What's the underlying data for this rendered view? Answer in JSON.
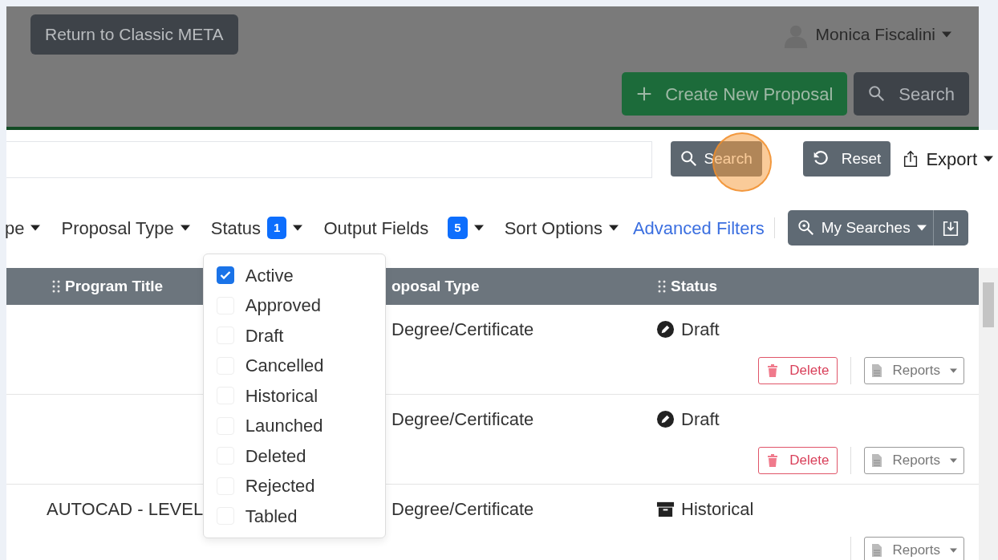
{
  "header": {
    "return_button": "Return to Classic META",
    "user_name": "Monica Fiscalini",
    "create_button": "Create New Proposal",
    "search_button": "Search"
  },
  "search_bar": {
    "search_button": "Search",
    "reset_button": "Reset",
    "export_button": "Export"
  },
  "filters": [
    {
      "kind": "dropdown",
      "label": "pe",
      "expanded": false
    },
    {
      "kind": "dropdown",
      "label": "Proposal Type",
      "expanded": false
    },
    {
      "kind": "dropdown",
      "label": "Status",
      "count": "1",
      "expanded": true
    },
    {
      "kind": "dropdown",
      "label": "Output Fields",
      "count": "5",
      "expanded": false
    },
    {
      "kind": "dropdown",
      "label": "Sort Options",
      "expanded": false
    },
    {
      "kind": "link",
      "label": "Advanced Filters"
    }
  ],
  "my_searches_button": "My Searches",
  "status_menu": [
    {
      "label": "Active",
      "checked": true
    },
    {
      "label": "Approved",
      "checked": false
    },
    {
      "label": "Draft",
      "checked": false
    },
    {
      "label": "Cancelled",
      "checked": false
    },
    {
      "label": "Historical",
      "checked": false
    },
    {
      "label": "Launched",
      "checked": false
    },
    {
      "label": "Deleted",
      "checked": false
    },
    {
      "label": "Rejected",
      "checked": false
    },
    {
      "label": "Tabled",
      "checked": false
    }
  ],
  "table": {
    "columns": [
      "Program Title",
      "oposal Type",
      "Status"
    ],
    "rows": [
      {
        "program_title": "",
        "proposal_type": "Degree/Certificate",
        "status": {
          "kind": "draft",
          "label": "Draft"
        },
        "delete_button": "Delete",
        "reports_button": "Reports"
      },
      {
        "program_title": "",
        "proposal_type": "Degree/Certificate",
        "status": {
          "kind": "draft",
          "label": "Draft"
        },
        "delete_button": "Delete",
        "reports_button": "Reports"
      },
      {
        "program_title": "AUTOCAD - LEVEL",
        "proposal_type": "Degree/Certificate",
        "status": {
          "kind": "historical",
          "label": "Historical"
        },
        "reports_button": "Reports"
      }
    ]
  }
}
